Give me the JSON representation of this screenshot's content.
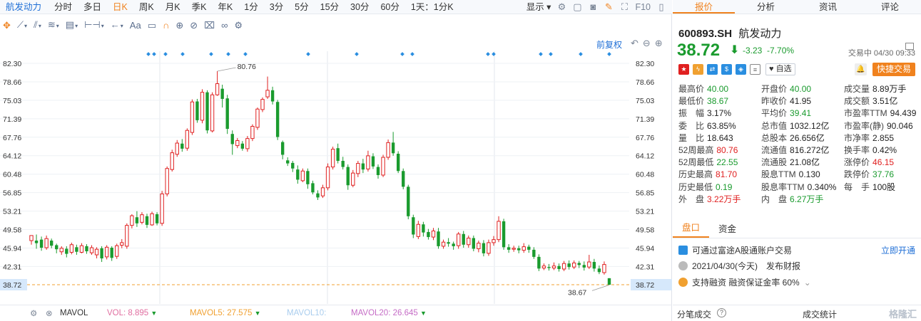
{
  "toolbar": {
    "symbol_tab": "航发动力",
    "tabs": [
      "分时",
      "多日",
      "日K",
      "周K",
      "月K",
      "季K",
      "年K",
      "1分",
      "3分",
      "5分",
      "15分",
      "30分",
      "60分",
      "1天：1分K"
    ],
    "active_tab": "日K",
    "display_label": "显示",
    "f10_label": "F10"
  },
  "drawing_tools": {
    "text_tool_label": "Aa"
  },
  "chart_header": {
    "fq_label": "前复权"
  },
  "chart_data": {
    "type": "candlestick",
    "y_ticks": [
      "82.30",
      "78.66",
      "75.03",
      "71.39",
      "67.76",
      "64.12",
      "60.48",
      "56.85",
      "53.21",
      "49.58",
      "45.94",
      "42.31",
      "38.72"
    ],
    "ylim": [
      38.72,
      82.3
    ],
    "current_price": 38.72,
    "high_label": "80.76",
    "low_label": "38.67",
    "candles": [
      [
        47.4,
        48.4,
        46.6,
        48.0
      ],
      [
        47.4,
        46.9,
        45.8,
        48.6
      ],
      [
        47.6,
        46.0,
        45.4,
        48.2
      ],
      [
        46.0,
        47.8,
        45.6,
        48.4
      ],
      [
        47.4,
        46.4,
        45.9,
        47.8
      ],
      [
        46.5,
        45.7,
        44.9,
        46.8
      ],
      [
        45.2,
        45.9,
        44.6,
        46.3
      ],
      [
        45.8,
        44.8,
        44.1,
        46.3
      ],
      [
        45.1,
        46.6,
        44.7,
        47.0
      ],
      [
        46.1,
        45.2,
        44.6,
        46.6
      ],
      [
        45.1,
        46.4,
        44.9,
        46.9
      ],
      [
        46.3,
        45.3,
        44.8,
        46.7
      ],
      [
        45.0,
        46.0,
        44.6,
        46.5
      ],
      [
        44.6,
        45.7,
        43.9,
        46.1
      ],
      [
        45.9,
        43.9,
        43.2,
        46.3
      ],
      [
        44.2,
        46.1,
        43.7,
        46.5
      ],
      [
        46.0,
        44.0,
        43.4,
        46.3
      ],
      [
        44.3,
        46.4,
        43.8,
        46.8
      ],
      [
        46.5,
        47.0,
        45.9,
        47.7
      ],
      [
        46.3,
        50.4,
        45.8,
        50.8
      ],
      [
        50.4,
        52.3,
        49.8,
        52.6
      ],
      [
        52.0,
        50.8,
        50.1,
        53.2
      ],
      [
        51.0,
        52.5,
        50.6,
        53.0
      ],
      [
        52.2,
        50.5,
        49.9,
        52.7
      ],
      [
        50.5,
        52.7,
        50.3,
        53.1
      ],
      [
        52.6,
        50.8,
        50.4,
        53.0
      ],
      [
        50.8,
        56.6,
        50.3,
        57.2
      ],
      [
        56.6,
        61.6,
        56.1,
        62.0
      ],
      [
        61.4,
        64.7,
        61.0,
        65.3
      ],
      [
        64.4,
        66.6,
        63.9,
        67.2
      ],
      [
        66.5,
        65.5,
        64.9,
        67.4
      ],
      [
        65.6,
        69.1,
        65.1,
        69.5
      ],
      [
        68.7,
        74.7,
        68.2,
        75.2
      ],
      [
        74.8,
        71.1,
        70.6,
        75.3
      ],
      [
        71.1,
        76.6,
        70.5,
        77.2
      ],
      [
        76.6,
        69.1,
        68.5,
        77.0
      ],
      [
        69.0,
        76.1,
        68.7,
        76.6
      ],
      [
        76.1,
        78.3,
        75.9,
        80.76
      ],
      [
        77.3,
        75.3,
        73.6,
        78.1
      ],
      [
        75.4,
        69.4,
        68.4,
        76.1
      ],
      [
        68.4,
        66.4,
        64.3,
        69.1
      ],
      [
        66.1,
        67.1,
        65.6,
        67.6
      ],
      [
        66.5,
        65.5,
        65.1,
        67.0
      ],
      [
        65.5,
        67.5,
        64.9,
        68.0
      ],
      [
        67.5,
        69.9,
        67.0,
        70.3
      ],
      [
        69.7,
        73.3,
        69.2,
        73.6
      ],
      [
        73.2,
        75.2,
        72.7,
        75.6
      ],
      [
        75.7,
        77.0,
        75.3,
        79.7
      ],
      [
        77.0,
        74.8,
        74.2,
        77.7
      ],
      [
        74.7,
        67.8,
        67.2,
        75.1
      ],
      [
        66.8,
        64.3,
        63.4,
        67.1
      ],
      [
        63.2,
        62.6,
        62.1,
        63.8
      ],
      [
        62.7,
        61.6,
        60.9,
        63.1
      ],
      [
        61.4,
        59.4,
        58.6,
        62.2
      ],
      [
        59.2,
        61.1,
        58.9,
        61.6
      ],
      [
        61.1,
        58.5,
        57.6,
        61.6
      ],
      [
        58.7,
        56.9,
        56.5,
        59.2
      ],
      [
        56.7,
        55.9,
        55.4,
        57.3
      ],
      [
        56.2,
        57.8,
        55.8,
        58.4
      ],
      [
        57.8,
        61.9,
        57.3,
        62.6
      ],
      [
        61.9,
        65.4,
        61.4,
        65.9
      ],
      [
        65.6,
        63.1,
        62.6,
        66.5
      ],
      [
        63.1,
        61.9,
        61.4,
        63.9
      ],
      [
        61.9,
        58.3,
        57.4,
        62.4
      ],
      [
        58.3,
        60.7,
        57.9,
        61.3
      ],
      [
        60.6,
        62.6,
        59.9,
        63.1
      ],
      [
        62.6,
        61.4,
        60.7,
        63.5
      ],
      [
        61.5,
        64.1,
        61.0,
        65.1
      ],
      [
        64.0,
        62.0,
        61.5,
        64.6
      ],
      [
        61.9,
        60.3,
        59.6,
        62.4
      ],
      [
        60.3,
        63.8,
        59.9,
        64.3
      ],
      [
        63.8,
        66.7,
        63.3,
        67.3
      ],
      [
        66.7,
        64.6,
        64.1,
        68.8
      ],
      [
        64.5,
        61.1,
        60.7,
        65.0
      ],
      [
        61.1,
        58.0,
        57.5,
        61.6
      ],
      [
        58.0,
        52.2,
        51.6,
        58.4
      ],
      [
        52.0,
        48.6,
        47.9,
        52.5
      ],
      [
        48.2,
        50.6,
        47.7,
        51.3
      ],
      [
        50.6,
        49.0,
        48.2,
        51.1
      ],
      [
        49.1,
        48.1,
        47.6,
        49.7
      ],
      [
        48.1,
        49.3,
        47.5,
        49.9
      ],
      [
        49.2,
        46.3,
        45.8,
        49.9
      ],
      [
        46.3,
        47.1,
        45.8,
        47.6
      ],
      [
        47.1,
        46.8,
        46.2,
        47.9
      ],
      [
        46.8,
        46.3,
        45.6,
        47.2
      ],
      [
        46.4,
        48.7,
        45.8,
        49.1
      ],
      [
        48.7,
        46.6,
        46.0,
        49.3
      ],
      [
        46.6,
        47.9,
        46.0,
        48.4
      ],
      [
        47.9,
        45.8,
        45.3,
        48.4
      ],
      [
        45.8,
        46.9,
        45.1,
        47.4
      ],
      [
        46.9,
        44.9,
        44.3,
        47.5
      ],
      [
        44.9,
        47.0,
        44.4,
        47.6
      ],
      [
        47.0,
        47.6,
        46.4,
        48.3
      ],
      [
        47.6,
        51.2,
        47.1,
        52.2
      ],
      [
        51.2,
        46.1,
        45.6,
        51.7
      ],
      [
        46.1,
        45.6,
        45.0,
        46.7
      ],
      [
        45.7,
        45.9,
        45.2,
        46.4
      ],
      [
        45.9,
        45.5,
        44.9,
        46.4
      ],
      [
        45.5,
        46.2,
        45.0,
        46.9
      ],
      [
        46.2,
        45.6,
        45.0,
        46.6
      ],
      [
        45.6,
        44.2,
        43.8,
        46.1
      ],
      [
        44.2,
        41.9,
        41.4,
        44.7
      ],
      [
        42.0,
        42.4,
        41.6,
        42.9
      ],
      [
        42.2,
        42.0,
        41.5,
        42.8
      ],
      [
        42.0,
        42.4,
        41.6,
        43.1
      ],
      [
        42.4,
        41.8,
        41.3,
        42.9
      ],
      [
        41.8,
        42.9,
        41.4,
        43.4
      ],
      [
        42.9,
        42.2,
        41.7,
        43.5
      ],
      [
        42.2,
        43.0,
        41.8,
        43.5
      ],
      [
        43.0,
        42.6,
        42.0,
        43.4
      ],
      [
        42.6,
        42.1,
        41.5,
        43.3
      ],
      [
        42.2,
        43.2,
        41.8,
        44.6
      ],
      [
        43.2,
        41.9,
        41.3,
        43.8
      ],
      [
        41.9,
        41.2,
        40.8,
        42.5
      ],
      [
        41.1,
        42.7,
        40.7,
        43.3
      ],
      [
        40.0,
        38.72,
        38.67,
        40.0
      ]
    ],
    "dividend_markers": [
      11,
      12,
      13,
      15,
      18,
      20,
      22,
      27,
      31,
      32,
      33,
      35,
      36,
      37,
      39,
      42
    ]
  },
  "bottom_bar": {
    "mavol_label": "MAVOL",
    "vol": "VOL: 8.895",
    "mavol5": "MAVOL5: 27.575",
    "mavol10": "MAVOL10:",
    "mavol20": "MAVOL20: 26.645"
  },
  "colors": {
    "up": "#e02020",
    "down": "#1a9b2e",
    "accent": "#f0821e",
    "link": "#1f6fd6"
  },
  "right_panel": {
    "tabs": [
      "报价",
      "分析",
      "资讯",
      "评论"
    ],
    "active_tab": "报价",
    "code": "600893.SH",
    "name": "航发动力",
    "price": "38.72",
    "change": "-3.23",
    "change_pct": "-7.70%",
    "status": "交易中 04/30 09:33",
    "zixuan_label": "自选",
    "trade_label": "快捷交易",
    "stats": [
      {
        "k": "最高价",
        "v": "40.00",
        "c": "g"
      },
      {
        "k": "开盘价",
        "v": "40.00",
        "c": "g"
      },
      {
        "k": "成交量",
        "v": "8.89万手",
        "c": "n"
      },
      {
        "k": "最低价",
        "v": "38.67",
        "c": "g"
      },
      {
        "k": "昨收价",
        "v": "41.95",
        "c": "n"
      },
      {
        "k": "成交额",
        "v": "3.51亿",
        "c": "n"
      },
      {
        "k": "振　幅",
        "v": "3.17%",
        "c": "n"
      },
      {
        "k": "平均价",
        "v": "39.41",
        "c": "g"
      },
      {
        "k": "市盈率TTM",
        "v": "94.439",
        "c": "n"
      },
      {
        "k": "委　比",
        "v": "63.85%",
        "c": "n"
      },
      {
        "k": "总市值",
        "v": "1032.12亿",
        "c": "n"
      },
      {
        "k": "市盈率(静)",
        "v": "90.046",
        "c": "n"
      },
      {
        "k": "量　比",
        "v": "18.643",
        "c": "n"
      },
      {
        "k": "总股本",
        "v": "26.656亿",
        "c": "n"
      },
      {
        "k": "市净率",
        "v": "2.855",
        "c": "n"
      },
      {
        "k": "52周最高",
        "v": "80.76",
        "c": "r"
      },
      {
        "k": "流通值",
        "v": "816.272亿",
        "c": "n"
      },
      {
        "k": "换手率",
        "v": "0.42%",
        "c": "n"
      },
      {
        "k": "52周最低",
        "v": "22.55",
        "c": "g"
      },
      {
        "k": "流通股",
        "v": "21.08亿",
        "c": "n"
      },
      {
        "k": "涨停价",
        "v": "46.15",
        "c": "r"
      },
      {
        "k": "历史最高",
        "v": "81.70",
        "c": "r"
      },
      {
        "k": "股息TTM",
        "v": "0.130",
        "c": "n"
      },
      {
        "k": "跌停价",
        "v": "37.76",
        "c": "g"
      },
      {
        "k": "历史最低",
        "v": "0.19",
        "c": "g"
      },
      {
        "k": "股息率TTM",
        "v": "0.340%",
        "c": "n"
      },
      {
        "k": "每　手",
        "v": "100股",
        "c": "n"
      },
      {
        "k": "外　盘",
        "v": "3.22万手",
        "c": "r"
      },
      {
        "k": "内　盘",
        "v": "6.27万手",
        "c": "g"
      },
      {
        "k": "",
        "v": "",
        "c": "n"
      }
    ],
    "section_tabs": [
      "盘口",
      "资金"
    ],
    "info1": "可通过富途A股通账户交易",
    "info1_link": "立即开通",
    "info2": "2021/04/30(今天)　发布财报",
    "info3": "支持融资  融资保证金率 60%",
    "footer_left": "分笔成交",
    "footer_mid": "成交统计",
    "watermark": "格隆汇"
  }
}
